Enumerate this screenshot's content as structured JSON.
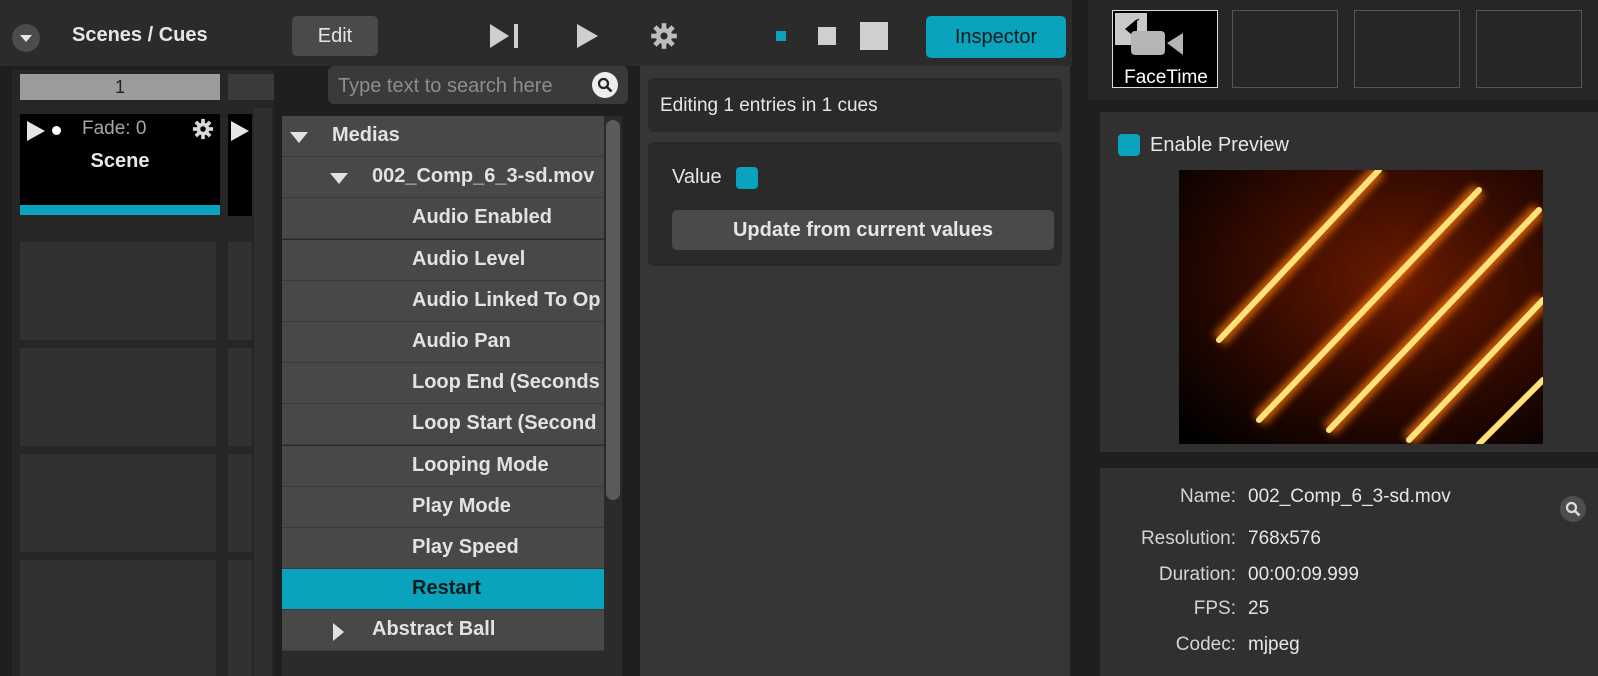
{
  "scenes": {
    "title": "Scenes / Cues",
    "tab_label": "1",
    "scene": {
      "name": "Scene",
      "fade_label": "Fade: 0"
    }
  },
  "toolbar": {
    "edit_label": "Edit",
    "inspector_label": "Inspector"
  },
  "search": {
    "placeholder": "Type text to search here"
  },
  "tree": {
    "items": [
      {
        "label": "Medias",
        "level": 0,
        "expanded": true
      },
      {
        "label": "002_Comp_6_3-sd.mov",
        "level": 1,
        "expanded": true
      },
      {
        "label": "Audio Enabled",
        "level": 2
      },
      {
        "label": "Audio Level",
        "level": 2
      },
      {
        "label": "Audio Linked To Op",
        "level": 2
      },
      {
        "label": "Audio Pan",
        "level": 2
      },
      {
        "label": "Loop End (Seconds",
        "level": 2
      },
      {
        "label": "Loop Start (Second",
        "level": 2
      },
      {
        "label": "Looping Mode",
        "level": 2
      },
      {
        "label": "Play Mode",
        "level": 2
      },
      {
        "label": "Play Speed",
        "level": 2
      },
      {
        "label": "Restart",
        "level": 2,
        "selected": true
      },
      {
        "label": "Abstract Ball",
        "level": 1,
        "expanded": false
      }
    ]
  },
  "inspector": {
    "editing_text": "Editing 1 entries in 1 cues",
    "value_label": "Value",
    "update_label": "Update from current values"
  },
  "sources": {
    "facetime_label": "FaceTime"
  },
  "preview": {
    "enable_label": "Enable Preview"
  },
  "info": {
    "rows": [
      {
        "key": "Name:",
        "value": "002_Comp_6_3-sd.mov"
      },
      {
        "key": "Resolution:",
        "value": "768x576"
      },
      {
        "key": "Duration:",
        "value": "00:00:09.999"
      },
      {
        "key": "FPS:",
        "value": "25"
      },
      {
        "key": "Codec:",
        "value": "mjpeg"
      }
    ]
  },
  "colors": {
    "accent": "#0aa3bd",
    "panel": "#2b2b2b",
    "row": "#484848"
  }
}
